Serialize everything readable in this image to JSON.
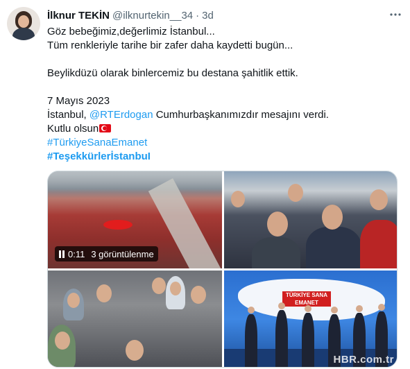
{
  "tweet": {
    "display_name": "İlknur TEKİN",
    "handle": "@ilknurtekin__34",
    "separator": "·",
    "time": "3d",
    "lines": [
      "Göz bebeğimiz,değerlimiz İstanbul...",
      "Tüm renkleriyle tarihe bir zafer daha kaydetti bugün..."
    ],
    "line3": "Beylikdüzü olarak binlercemiz bu destana şahitlik ettik.",
    "date_line": "7 Mayıs 2023",
    "mention_prefix": "İstanbul, ",
    "mention": "@RTErdogan",
    "mention_suffix": " Cumhurbaşkanımızdır mesajını verdi.",
    "wish": "Kutlu olsun",
    "flag_icon": "turkey-flag-icon",
    "hashtag1": "#TürkiyeSanaEmanet",
    "hashtag2": "#TeşekkürlerİstanbuI",
    "more_icon": "more-horizontal-icon"
  },
  "media": {
    "video_time": "0:11",
    "video_views": "3 görüntülenme",
    "stage_banner": "TÜRKİYE SANA EMANET",
    "watermark": "HBR.com.tr"
  },
  "colors": {
    "link": "#1d9bf0",
    "text": "#0f1419",
    "secondary": "#536471",
    "border": "#cfd9de"
  }
}
